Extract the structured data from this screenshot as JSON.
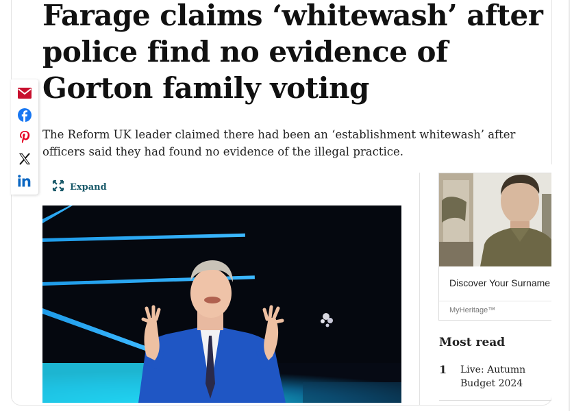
{
  "article": {
    "headline": "Farage claims ‘whitewash’ after police find no evidence of Gorton family voting",
    "standfirst": "The Reform UK leader claimed there had been an ‘establishment whitewash’ after officers said they had found no evidence of the illegal practice."
  },
  "share": {
    "icons": [
      "email-icon",
      "facebook-icon",
      "pinterest-icon",
      "x-icon",
      "linkedin-icon"
    ]
  },
  "media": {
    "expand_label": "Expand"
  },
  "sidebar": {
    "ad": {
      "title": "Discover Your Surname",
      "source": "MyHeritage™"
    },
    "most_read": {
      "heading": "Most read",
      "items": [
        {
          "rank": "1",
          "text": "Live: Autumn Budget 2024"
        }
      ]
    }
  },
  "colors": {
    "accent": "#1a5a6a",
    "email": "#c8102e",
    "facebook": "#1877f2",
    "pinterest": "#e60023",
    "linkedin": "#0a66c2"
  }
}
